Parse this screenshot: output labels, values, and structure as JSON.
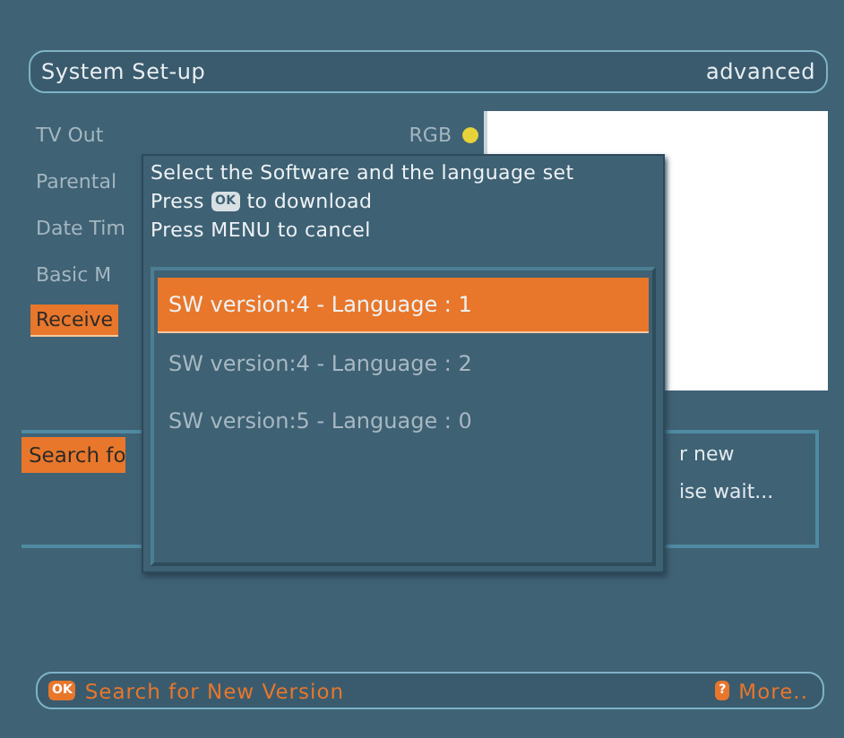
{
  "header": {
    "title": "System Set-up",
    "mode": "advanced"
  },
  "menu": [
    {
      "label": "TV Out",
      "value": "RGB",
      "selected": false
    },
    {
      "label": "Parental",
      "selected": false
    },
    {
      "label": "Date Tim",
      "selected": false
    },
    {
      "label": "Basic M",
      "selected": false
    },
    {
      "label": "Receive",
      "selected": true
    }
  ],
  "search_panel": {
    "button": "Search fo",
    "lines": [
      "r new",
      "ise wait..."
    ]
  },
  "dialog": {
    "lines": [
      {
        "kind": "plain",
        "text": "Select the Software and the language set"
      },
      {
        "kind": "key",
        "before": "Press",
        "key": "OK",
        "after": "to download"
      },
      {
        "kind": "plain",
        "text": "Press MENU to cancel"
      }
    ],
    "items": [
      {
        "label": "SW version:4 - Language : 1",
        "selected": true
      },
      {
        "label": "SW version:4 - Language : 2",
        "selected": false
      },
      {
        "label": "SW version:5 - Language : 0",
        "selected": false
      }
    ]
  },
  "footer": [
    {
      "key": "OK",
      "label": "Search for New Version"
    },
    {
      "key": "?",
      "label": "More.."
    }
  ]
}
